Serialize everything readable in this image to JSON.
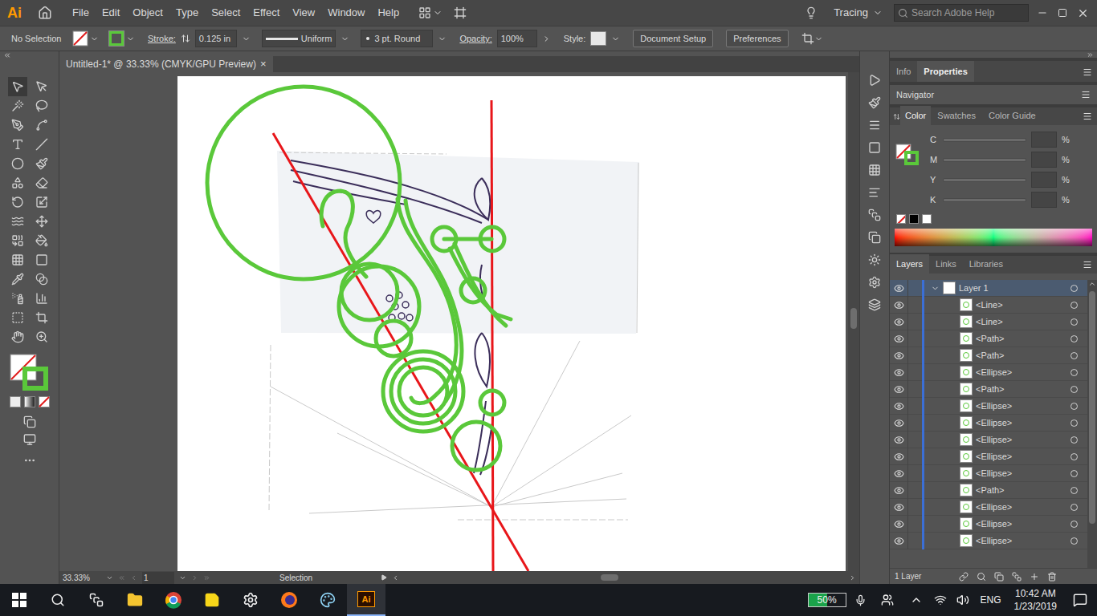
{
  "app": {
    "logo": "Ai",
    "menus": [
      "File",
      "Edit",
      "Object",
      "Type",
      "Select",
      "Effect",
      "View",
      "Window",
      "Help"
    ],
    "workspace": "Tracing",
    "search_placeholder": "Search Adobe Help"
  },
  "control_bar": {
    "selection": "No Selection",
    "stroke_label": "Stroke:",
    "stroke_weight": "0.125 in",
    "profile": "Uniform",
    "brush": "3 pt. Round",
    "opacity_label": "Opacity:",
    "opacity": "100%",
    "style_label": "Style:",
    "buttons": [
      "Document Setup",
      "Preferences"
    ]
  },
  "document_tab": {
    "title": "Untitled-1* @ 33.33% (CMYK/GPU Preview)",
    "close": "×"
  },
  "status_bar": {
    "zoom": "33.33%",
    "artboard": "1",
    "tool": "Selection"
  },
  "panels": {
    "top_tabs": [
      {
        "label": "Info",
        "selected": false
      },
      {
        "label": "Properties",
        "selected": true
      }
    ],
    "navigator": "Navigator",
    "color_tabs": [
      {
        "label": "Color",
        "selected": true
      },
      {
        "label": "Swatches",
        "selected": false
      },
      {
        "label": "Color Guide",
        "selected": false
      }
    ],
    "color_channels": [
      {
        "name": "C",
        "value": "",
        "unit": "%"
      },
      {
        "name": "M",
        "value": "",
        "unit": "%"
      },
      {
        "name": "Y",
        "value": "",
        "unit": "%"
      },
      {
        "name": "K",
        "value": "",
        "unit": "%"
      }
    ],
    "layers_tabs": [
      {
        "label": "Layers",
        "selected": true
      },
      {
        "label": "Links",
        "selected": false
      },
      {
        "label": "Libraries",
        "selected": false
      }
    ],
    "layers": [
      {
        "name": "Layer 1",
        "kind": "layer",
        "expanded": true,
        "visible": true,
        "selected": true
      },
      {
        "name": "<Line>",
        "kind": "item",
        "visible": true,
        "selected": false
      },
      {
        "name": "<Line>",
        "kind": "item",
        "visible": true,
        "selected": false
      },
      {
        "name": "<Path>",
        "kind": "item",
        "visible": true,
        "selected": false
      },
      {
        "name": "<Path>",
        "kind": "item",
        "visible": true,
        "selected": false
      },
      {
        "name": "<Ellipse>",
        "kind": "item",
        "visible": true,
        "selected": false
      },
      {
        "name": "<Path>",
        "kind": "item",
        "visible": true,
        "selected": false
      },
      {
        "name": "<Ellipse>",
        "kind": "item",
        "visible": true,
        "selected": false
      },
      {
        "name": "<Ellipse>",
        "kind": "item",
        "visible": true,
        "selected": false
      },
      {
        "name": "<Ellipse>",
        "kind": "item",
        "visible": true,
        "selected": false
      },
      {
        "name": "<Ellipse>",
        "kind": "item",
        "visible": true,
        "selected": false
      },
      {
        "name": "<Ellipse>",
        "kind": "item",
        "visible": true,
        "selected": false
      },
      {
        "name": "<Path>",
        "kind": "item",
        "visible": true,
        "selected": false
      },
      {
        "name": "<Ellipse>",
        "kind": "item",
        "visible": true,
        "selected": false
      },
      {
        "name": "<Ellipse>",
        "kind": "item",
        "visible": true,
        "selected": false
      },
      {
        "name": "<Ellipse>",
        "kind": "item",
        "visible": true,
        "selected": false
      }
    ],
    "layer_count": "1 Layer"
  },
  "taskbar": {
    "battery": "50%",
    "battery_level": 0.5,
    "language": "ENG",
    "time": "10:42 AM",
    "date": "1/23/2019"
  }
}
